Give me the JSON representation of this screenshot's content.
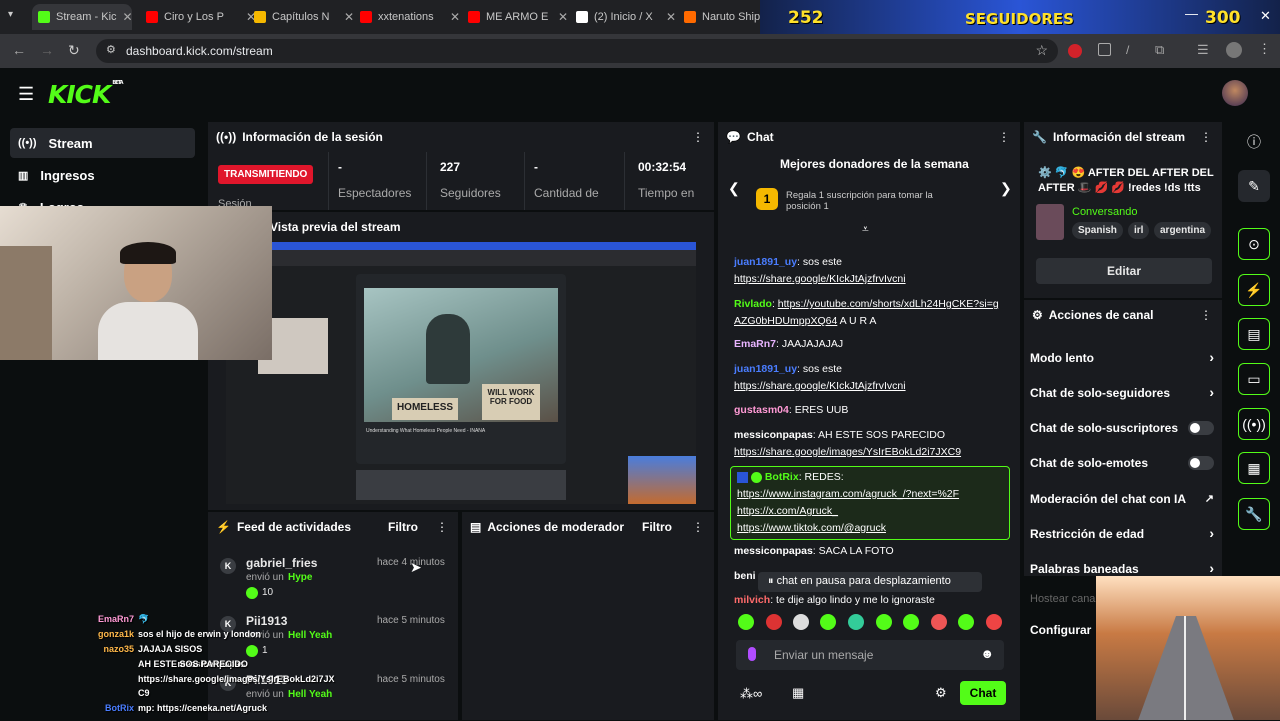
{
  "browser": {
    "tabs": [
      {
        "label": "Stream - Kic",
        "color": "#53fc18"
      },
      {
        "label": "Ciro y Los P",
        "color": "#ff0000"
      },
      {
        "label": "Capítulos N",
        "color": "#f5b800"
      },
      {
        "label": "xxtenations",
        "color": "#ff0000"
      },
      {
        "label": "ME ARMO E",
        "color": "#ff0000"
      },
      {
        "label": "(2) Inicio / X",
        "color": "#ffffff"
      },
      {
        "label": "Naruto Ship",
        "color": "#ff6a00"
      }
    ],
    "url": "dashboard.kick.com/stream"
  },
  "overlay_bar": {
    "left": "252",
    "center": "SEGUIDORES",
    "right": "300"
  },
  "brand": {
    "logo": "KICK",
    "beta": "BETA"
  },
  "sidebar": {
    "items": [
      {
        "label": "Stream"
      },
      {
        "label": "Ingresos"
      },
      {
        "label": "Logros"
      }
    ]
  },
  "session": {
    "title": "Información de la sesión",
    "status": "TRANSMITIENDO",
    "status_sub": "Sesión",
    "stats": [
      {
        "value": "-",
        "label": "Espectadores"
      },
      {
        "value": "227",
        "label": "Seguidores"
      },
      {
        "value": "-",
        "label": "Cantidad de"
      },
      {
        "value": "00:32:54",
        "label": "Tiempo en"
      }
    ]
  },
  "preview": {
    "title": "Vista previa del stream",
    "tv_title": "Understanding What Homeless People Need - INANA",
    "sign1": "HOMELESS",
    "sign2": "WILL WORK FOR FOOD"
  },
  "feed": {
    "title": "Feed de actividades",
    "filter": "Filtro",
    "items": [
      {
        "user": "gabriel_fries",
        "time": "hace 4 minutos",
        "action": "envió un",
        "item": "Hype",
        "amount": "10"
      },
      {
        "user": "Pii1913",
        "time": "hace 5 minutos",
        "action": "envió un",
        "item": "Hell Yeah",
        "amount": "1"
      },
      {
        "user": "Pii1913",
        "time": "hace 5 minutos",
        "action": "envió un",
        "item": "Hell Yeah",
        "amount": ""
      }
    ]
  },
  "moderator": {
    "title": "Acciones de moderador",
    "filter": "Filtro"
  },
  "chat": {
    "title": "Chat",
    "donors_title": "Mejores donadores de la semana",
    "donors_text": "Regala 1 suscripción para tomar la posición 1",
    "rank": "1",
    "messages": [
      {
        "user": "juan1891_uy",
        "color": "#4a7dff",
        "text": ": sos este",
        "link": "https://share.google/KIckJtAjzfrvIvcni"
      },
      {
        "user": "Rivlado",
        "color": "#53fc18",
        "text": ":",
        "link": "https://youtube.com/shorts/xdLh24HgCKE?si=gAZG0bHDUmppXQ64",
        "tail": " A U R A"
      },
      {
        "user": "EmaRn7",
        "color": "#e8b4ff",
        "text": ": JAAJAJAJAJ"
      },
      {
        "user": "juan1891_uy",
        "color": "#4a7dff",
        "text": ": sos este",
        "link": "https://share.google/KIckJtAjzfrvIvcni"
      },
      {
        "user": "gustasm04",
        "color": "#ff9ad5",
        "text": ": ERES UUB"
      },
      {
        "user": "messiconpapas",
        "color": "#e0e0e0",
        "text": ": AH ESTE SOS PARECIDO",
        "link": "https://share.google/images/YsIrEBokLd2i7JXC9"
      },
      {
        "user": "BotRix",
        "color": "#53fc18",
        "text": ": REDES:",
        "links": [
          "https://www.instagram.com/agruck_/?next=%2F",
          "https://x.com/Agruck_",
          "https://www.tiktok.com/@agruck"
        ]
      },
      {
        "user": "messiconpapas",
        "color": "#e0e0e0",
        "text": ": SACA LA FOTO"
      },
      {
        "user": "beni",
        "color": "#e0e0e0",
        "text": ""
      },
      {
        "user": "milvich",
        "color": "#ff6b6b",
        "text": ": te dije algo lindo y me lo ignoraste"
      }
    ],
    "paused": "chat en pausa para desplazamiento",
    "input_placeholder": "Enviar un mensaje",
    "send": "Chat"
  },
  "stream_info": {
    "title": "Información del stream",
    "stream_title": "⚙️ 🐬 😍 AFTER DEL AFTER DEL AFTER 🎩 💋 💋 !redes !ds !tts",
    "category": "Conversando",
    "tags": [
      "Spanish",
      "irl",
      "argentina"
    ],
    "edit": "Editar"
  },
  "channel_actions": {
    "title": "Acciones de canal",
    "items": [
      {
        "label": "Modo lento",
        "kind": "chevron"
      },
      {
        "label": "Chat de solo-seguidores",
        "kind": "chevron"
      },
      {
        "label": "Chat de solo-suscriptores",
        "kind": "toggle"
      },
      {
        "label": "Chat de solo-emotes",
        "kind": "toggle"
      },
      {
        "label": "Moderación del chat con IA",
        "kind": "external"
      },
      {
        "label": "Restricción de edad",
        "kind": "chevron"
      },
      {
        "label": "Palabras baneadas",
        "kind": "chevron"
      },
      {
        "label": "Hostear canal",
        "kind": "none"
      },
      {
        "label": "Configurar",
        "kind": "none"
      }
    ]
  },
  "overlay_chat": [
    {
      "user": "EmaRn7",
      "text": "🐬"
    },
    {
      "user": "gonza1k",
      "text": "sos el hijo de erwin y london"
    },
    {
      "user": "nazo35",
      "text": "JAJAJA SISOS"
    },
    {
      "user": "messiconpapas",
      "text": "AH ESTE SOS PARECIDO"
    },
    {
      "user": "",
      "text": "https://share.google/images/YsIrEBokLd2i7JX"
    },
    {
      "user": "",
      "text": "C9"
    },
    {
      "user": "BotRix",
      "text": "mp: https://ceneka.net/Agruck"
    }
  ]
}
